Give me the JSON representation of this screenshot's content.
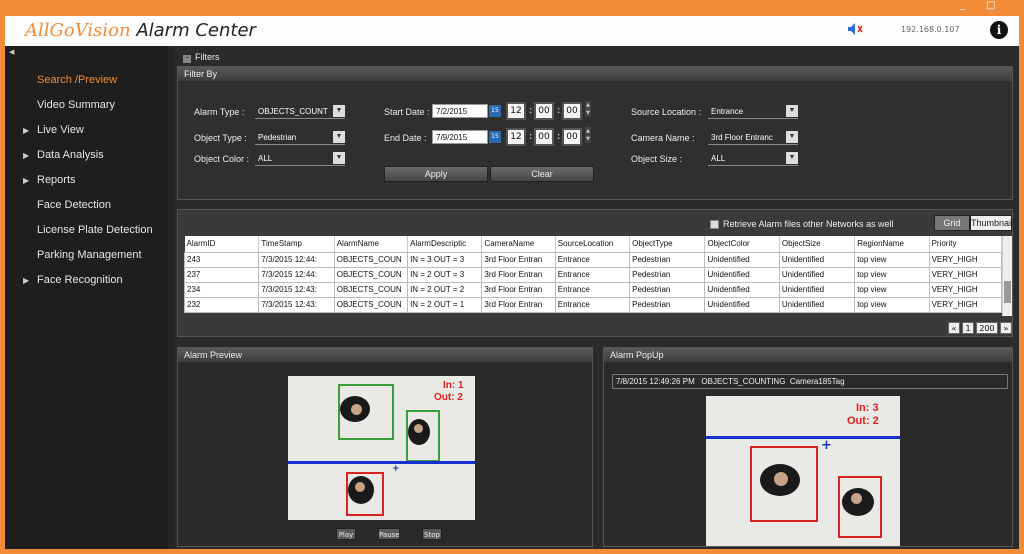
{
  "app": {
    "brand_part1": "AllGoVision",
    "brand_part2": "Alarm Center",
    "ip": "192.168.0.107",
    "info": "i",
    "minimize": "_",
    "maximize": "□"
  },
  "sidebar": {
    "items": [
      {
        "label": "Search /Preview",
        "arrow": false,
        "active": true
      },
      {
        "label": "Video Summary",
        "arrow": false
      },
      {
        "label": "Live View",
        "arrow": true
      },
      {
        "label": "Data Analysis",
        "arrow": true
      },
      {
        "label": "Reports",
        "arrow": true
      },
      {
        "label": "Face Detection",
        "arrow": false
      },
      {
        "label": "License Plate Detection",
        "arrow": false
      },
      {
        "label": "Parking Management",
        "arrow": false
      },
      {
        "label": "Face Recognition",
        "arrow": true
      }
    ]
  },
  "filters": {
    "section_title": "Filters",
    "filter_by": "Filter By",
    "alarm_type_label": "Alarm Type :",
    "alarm_type_value": "OBJECTS_COUNT",
    "object_type_label": "Object Type :",
    "object_type_value": "Pedestrian",
    "object_color_label": "Object Color :",
    "object_color_value": "ALL",
    "start_date_label": "Start Date :",
    "start_date_value": "7/2/2015",
    "end_date_label": "End Date :",
    "end_date_value": "7/9/2015",
    "start_time": {
      "h": "12",
      "m": "00",
      "s": "00"
    },
    "end_time": {
      "h": "12",
      "m": "00",
      "s": "00"
    },
    "source_location_label": "Source Location :",
    "source_location_value": "Entrance",
    "camera_name_label": "Camera Name :",
    "camera_name_value": "3rd Floor Entranc",
    "object_size_label": "Object Size :",
    "object_size_value": "ALL",
    "apply": "Apply",
    "clear": "Clear"
  },
  "results": {
    "retrieve_label": "Retrieve Alarm files other Networks as well",
    "grid_tab": "Grid",
    "thumbnail_tab": "Thumbnail",
    "columns": [
      "AlarmID",
      "TimeStamp",
      "AlarmName",
      "AlarmDescriptic",
      "CameraName",
      "SourceLocation",
      "ObjectType",
      "ObjectColor",
      "ObjectSize",
      "RegionName",
      "Priority"
    ],
    "rows": [
      [
        "243",
        "7/3/2015 12:44:",
        "OBJECTS_COUN",
        "IN = 3 OUT = 3",
        "3rd Floor Entran",
        "Entrance",
        "Pedestrian",
        "Unidentified",
        "Unidentified",
        "top view",
        "VERY_HIGH"
      ],
      [
        "237",
        "7/3/2015 12:44:",
        "OBJECTS_COUN",
        "IN = 2 OUT = 3",
        "3rd Floor Entran",
        "Entrance",
        "Pedestrian",
        "Unidentified",
        "Unidentified",
        "top view",
        "VERY_HIGH"
      ],
      [
        "234",
        "7/3/2015 12:43:",
        "OBJECTS_COUN",
        "IN = 2 OUT = 2",
        "3rd Floor Entran",
        "Entrance",
        "Pedestrian",
        "Unidentified",
        "Unidentified",
        "top view",
        "VERY_HIGH"
      ],
      [
        "232",
        "7/3/2015 12:43:",
        "OBJECTS_COUN",
        "IN = 2 OUT = 1",
        "3rd Floor Entran",
        "Entrance",
        "Pedestrian",
        "Unidentified",
        "Unidentified",
        "top view",
        "VERY_HIGH"
      ]
    ],
    "page_current": "1",
    "page_total": "200",
    "prev": "«",
    "next": "»"
  },
  "preview": {
    "title": "Alarm Preview",
    "in_text": "In: 1",
    "out_text": "Out: 2",
    "play": "Play",
    "pause": "Pause",
    "stop": "Stop"
  },
  "popup": {
    "title": "Alarm PopUp",
    "timestamp": "7/8/2015 12:49:26 PM",
    "alarm": "OBJECTS_COUNTING",
    "camera": "Camera185Tag",
    "in_text": "In: 3",
    "out_text": "Out: 2"
  },
  "colors": {
    "accent": "#f28c38",
    "count_text": "#e02020",
    "line": "#1530d0"
  }
}
